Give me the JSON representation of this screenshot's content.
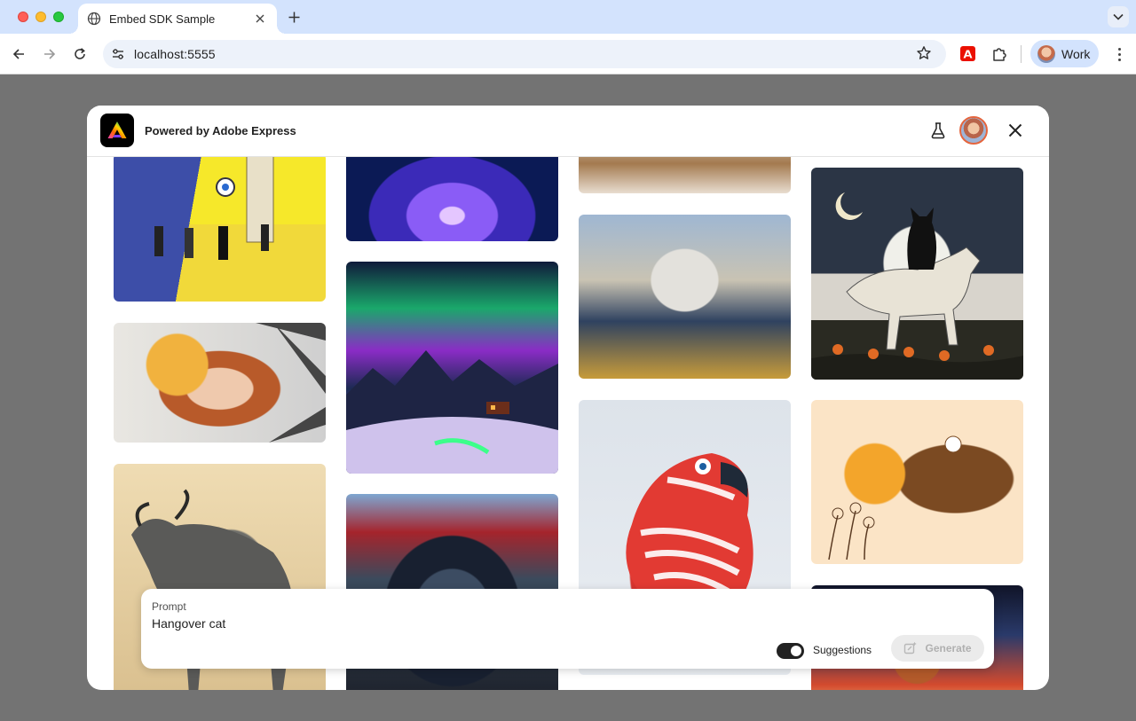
{
  "browser": {
    "tab_title": "Embed SDK Sample",
    "url": "localhost:5555",
    "profile_label": "Work"
  },
  "modal": {
    "header_title": "Powered by Adobe Express"
  },
  "prompt": {
    "label": "Prompt",
    "value": "Hangover cat",
    "suggestions_label": "Suggestions",
    "suggestions_on": true,
    "generate_label": "Generate"
  },
  "gallery": {
    "images": [
      "door-with-eye-illustration",
      "glowing-lotus",
      "tiger",
      "black-cat-on-horse",
      "red-haired-woman-portrait",
      "aurora-over-snowy-valley",
      "marble-statue-in-water",
      "wildebeest-illustration",
      "robot-in-glass-dome",
      "red-and-white-parrot",
      "woman-with-sun-illustration",
      "space-scene"
    ]
  }
}
